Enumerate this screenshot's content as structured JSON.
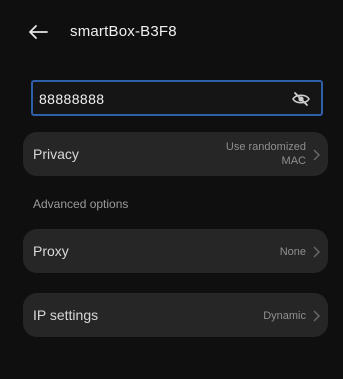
{
  "header": {
    "title": "smartBox-B3F8"
  },
  "password": {
    "value": "88888888"
  },
  "privacy": {
    "label": "Privacy",
    "value_line1": "Use randomized",
    "value_line2": "MAC"
  },
  "advanced": {
    "label": "Advanced options"
  },
  "proxy": {
    "label": "Proxy",
    "value": "None"
  },
  "ip": {
    "label": "IP settings",
    "value": "Dynamic"
  },
  "colors": {
    "accent": "#2f5fa8",
    "background": "#0f0f0f",
    "card": "#262626"
  }
}
